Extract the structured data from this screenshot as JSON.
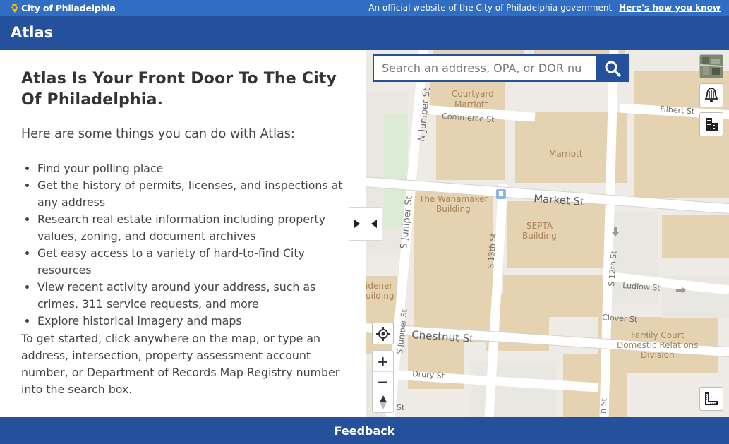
{
  "topbar": {
    "brand": "City of Philadelphia",
    "official_text": "An official website of the City of Philadelphia government",
    "how_link": "Here's how you know"
  },
  "app": {
    "title": "Atlas"
  },
  "left": {
    "heading": "Atlas Is Your Front Door To The City Of Philadelphia.",
    "intro": "Here are some things you can do with Atlas:",
    "items": [
      "Find your polling place",
      "Get the history of permits, licenses, and inspections at any address",
      "Research real estate information including property values, zoning, and document archives",
      "Get easy access to a variety of hard-to-find City resources",
      "View recent activity around your address, such as crimes, 311 service requests, and more",
      "Explore historical imagery and maps"
    ],
    "howto": "To get started, click anywhere on the map, or type an address, intersection, property assessment account number, or Department of Records Map Registry number into the search box."
  },
  "search": {
    "placeholder": "Search an address, OPA, or DOR nu"
  },
  "map": {
    "labels": {
      "courtyard": "Courtyard",
      "marriott": "Marriott",
      "commerce": "Commerce St",
      "marriott2": "Marriott",
      "filbert": "Filbert St",
      "n_juniper": "N Juniper St",
      "s_juniper": "S Juniper St",
      "s_juniper2": "S Juniper St",
      "wanamaker1": "The Wanamaker",
      "wanamaker2": "Building",
      "market": "Market St",
      "septa1": "SEPTA",
      "septa2": "Building",
      "s13": "S 13th St",
      "s12": "S 12th St",
      "ludlow": "Ludlow St",
      "widener1": "idener",
      "widener2": "uilding",
      "clover": "Clover St",
      "chestnut": "Chestnut St",
      "family1": "Family Court",
      "family2": "Domestic Relations",
      "family3": "Division",
      "drury": "Drury St",
      "st_bottom": "St",
      "h_st": "h St"
    }
  },
  "controls": {
    "zoom_in": "+",
    "zoom_out": "−"
  },
  "footer": {
    "feedback": "Feedback"
  },
  "colors": {
    "topbar": "#2f6ec3",
    "appbar": "#25509c",
    "building": "#e6d3b3",
    "road": "#ffffff"
  }
}
